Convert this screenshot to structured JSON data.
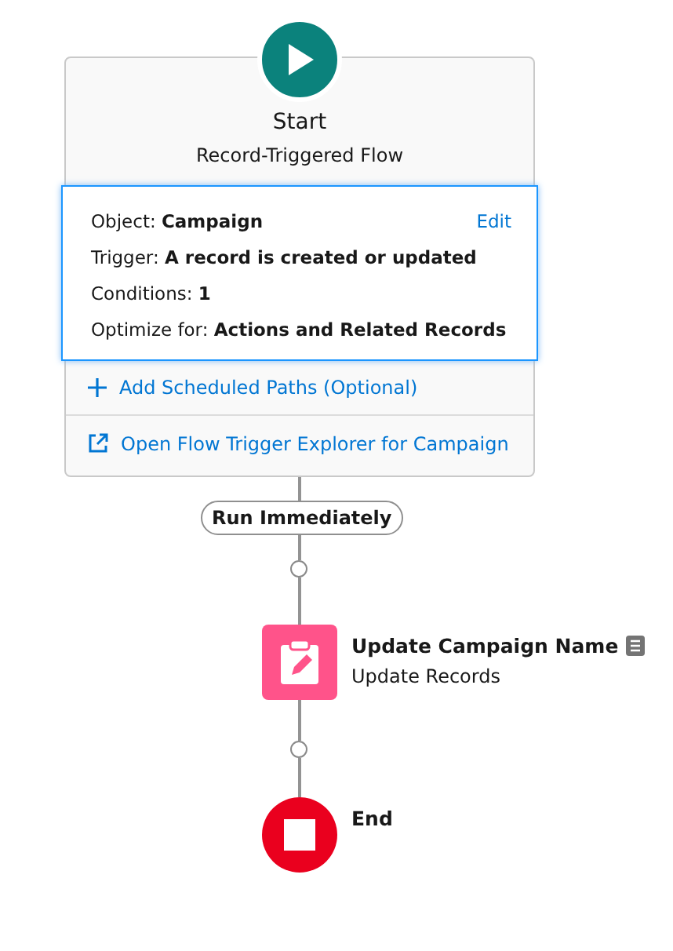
{
  "start": {
    "title": "Start",
    "subtitle": "Record-Triggered Flow",
    "edit_link": "Edit",
    "details": [
      "Object: **Campaign**",
      "Trigger: **A record is created or updated**",
      "Conditions: **1**",
      "Optimize for: **Actions and Related Records**"
    ],
    "actions": [
      {
        "kind": "add",
        "label": "Add Scheduled Paths (Optional)"
      },
      {
        "kind": "external",
        "label": "Open Flow Trigger Explorer for Campaign"
      }
    ]
  },
  "path_label": "Run Immediately",
  "elements": [
    {
      "kind": "update",
      "title": "Update Campaign Name",
      "subtitle": "Update Records"
    },
    {
      "kind": "end",
      "title": "End"
    }
  ]
}
